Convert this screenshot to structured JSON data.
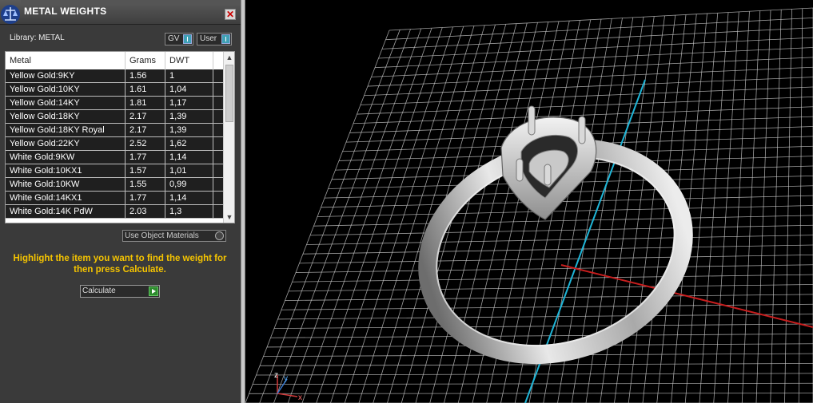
{
  "panel": {
    "title": "METAL WEIGHTS",
    "close_glyph": "✕",
    "library_label": "Library: METAL",
    "toggles": {
      "gv_label": "GV",
      "user_label": "User"
    },
    "table": {
      "headers": {
        "metal": "Metal",
        "grams": "Grams",
        "dwt": "DWT"
      },
      "rows": [
        {
          "metal": "Yellow Gold:9KY",
          "grams": "1.56",
          "dwt": "1"
        },
        {
          "metal": "Yellow Gold:10KY",
          "grams": "1.61",
          "dwt": "1,04"
        },
        {
          "metal": "Yellow Gold:14KY",
          "grams": "1.81",
          "dwt": "1,17"
        },
        {
          "metal": "Yellow Gold:18KY",
          "grams": "2.17",
          "dwt": "1,39"
        },
        {
          "metal": "Yellow Gold:18KY Royal",
          "grams": "2.17",
          "dwt": "1,39"
        },
        {
          "metal": "Yellow Gold:22KY",
          "grams": "2.52",
          "dwt": "1,62"
        },
        {
          "metal": "White Gold:9KW",
          "grams": "1.77",
          "dwt": "1,14"
        },
        {
          "metal": "White Gold:10KX1",
          "grams": "1.57",
          "dwt": "1,01"
        },
        {
          "metal": "White Gold:10KW",
          "grams": "1.55",
          "dwt": "0,99"
        },
        {
          "metal": "White Gold:14KX1",
          "grams": "1.77",
          "dwt": "1,14"
        },
        {
          "metal": "White Gold:14K PdW",
          "grams": "2.03",
          "dwt": "1,3"
        }
      ]
    },
    "use_object_materials": "Use Object Materials",
    "hint": "Highlight the item you want to find the weight for then press Calculate.",
    "calculate_label": "Calculate"
  },
  "viewport": {
    "axis_labels": {
      "z": "z",
      "y": "y",
      "x": "x"
    },
    "colors": {
      "grid": "#d0d0d0",
      "x_axis": "#c81e1e",
      "y_axis": "#1fb6d8",
      "ring": "#c8c8c8",
      "hint_text": "#f5c400"
    }
  }
}
